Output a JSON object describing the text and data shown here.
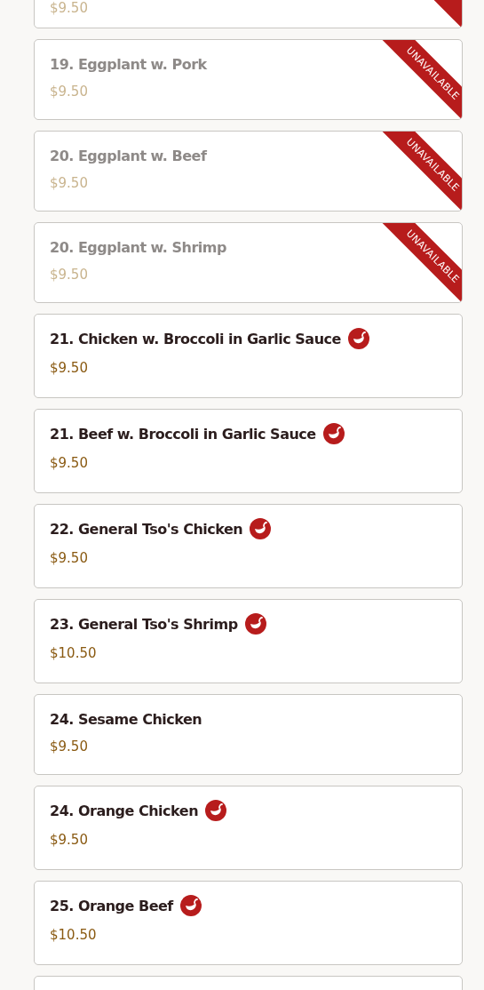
{
  "menu_items": [
    {
      "price": "$9.50",
      "unavailable": true,
      "spicy": false
    },
    {
      "name": "19. Eggplant w. Pork",
      "price": "$9.50",
      "unavailable": true,
      "ribbon": "UNAVAILABLE",
      "spicy": false
    },
    {
      "name": "20. Eggplant w. Beef",
      "price": "$9.50",
      "unavailable": true,
      "ribbon": "UNAVAILABLE",
      "spicy": false
    },
    {
      "name": "20. Eggplant w. Shrimp",
      "price": "$9.50",
      "unavailable": true,
      "ribbon": "UNAVAILABLE",
      "spicy": false
    },
    {
      "name": "21. Chicken w. Broccoli in Garlic Sauce",
      "price": "$9.50",
      "unavailable": false,
      "spicy": true
    },
    {
      "name": "21. Beef w. Broccoli in Garlic Sauce",
      "price": "$9.50",
      "unavailable": false,
      "spicy": true
    },
    {
      "name": "22. General Tso's Chicken",
      "price": "$9.50",
      "unavailable": false,
      "spicy": true
    },
    {
      "name": "23. General Tso's Shrimp",
      "price": "$10.50",
      "unavailable": false,
      "spicy": true
    },
    {
      "name": "24. Sesame Chicken",
      "price": "$9.50",
      "unavailable": false,
      "spicy": false
    },
    {
      "name": "24. Orange Chicken",
      "price": "$9.50",
      "unavailable": false,
      "spicy": true
    },
    {
      "name": "25. Orange Beef",
      "price": "$10.50",
      "unavailable": false,
      "spicy": true
    },
    {
      "unavailable": false
    }
  ]
}
